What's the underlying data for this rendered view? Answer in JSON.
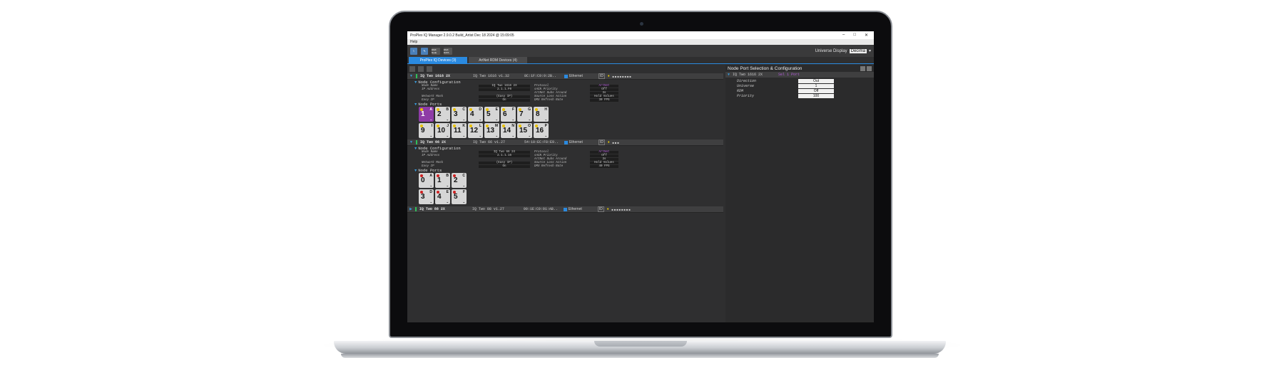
{
  "app": {
    "title": "ProPlex IQ Manager 2.9.0.2 Build_Artist Dec 18 2024 @ 15:09:05",
    "menu": "Help"
  },
  "toolbar": {
    "icon_a": "DMX Node",
    "icon_b": "DMX DATA",
    "universe_label": "Universe Display",
    "universe_value": "Decima"
  },
  "tabs": [
    "ProPlex IQ Devices (3)",
    "ArtNet RDM Devices (4)"
  ],
  "devices": [
    {
      "name": "IQ Two 1616 2X",
      "firmware": "IQ Two 1616 v1.32",
      "mac": "8C:1F:C9:9:2B..",
      "link": "Ethernet",
      "id": "ID",
      "config": {
        "node_name_label": "Node Name",
        "node_name": "IQ Two 1616 2X",
        "ip_label": "IP Address",
        "ip": "2.1.1.F0",
        "mask_label": "Network Mask",
        "mask": "(Easy IP)",
        "easy_ip_label": "Easy IP",
        "easy_ip": "On",
        "protocol_label": "Protocol",
        "protocol": "ArtNet",
        "sacn_label": "sACN Priority",
        "sacn": "Off",
        "artnet_label": "ArtNet Subs Around",
        "artnet": "3s",
        "source_label": "Source Loss Action",
        "source": "Hold Values",
        "refresh_label": "DMX Refresh Rate",
        "refresh": "30 FPS"
      },
      "ports": [
        {
          "num": "1",
          "let": "A"
        },
        {
          "num": "2",
          "let": "B"
        },
        {
          "num": "3",
          "let": "C"
        },
        {
          "num": "4",
          "let": "D"
        },
        {
          "num": "5",
          "let": "E"
        },
        {
          "num": "6",
          "let": "F"
        },
        {
          "num": "7",
          "let": "G"
        },
        {
          "num": "8",
          "let": "H"
        },
        {
          "num": "9",
          "let": "I"
        },
        {
          "num": "10",
          "let": "J"
        },
        {
          "num": "11",
          "let": "K"
        },
        {
          "num": "12",
          "let": "L"
        },
        {
          "num": "13",
          "let": "M"
        },
        {
          "num": "14",
          "let": "N"
        },
        {
          "num": "15",
          "let": "O"
        },
        {
          "num": "16",
          "let": "P"
        }
      ]
    },
    {
      "name": "IQ Two 66 2X",
      "firmware": "IQ Two 66 v1.27",
      "mac": "54:10:EC:F8:E9..",
      "link": "Ethernet",
      "id": "ID",
      "config": {
        "node_name_label": "Node Name",
        "node_name": "IQ Two 66 2X",
        "ip_label": "IP Address",
        "ip": "2.1.1.16",
        "mask_label": "Network Mask",
        "mask": "(Easy IP)",
        "easy_ip_label": "Easy IP",
        "easy_ip": "On",
        "protocol_label": "Protocol",
        "protocol": "ArtNet",
        "sacn_label": "sACN Priority",
        "sacn": "Off",
        "artnet_label": "ArtNet Subs Around",
        "artnet": "3s",
        "source_label": "Source Loss Action",
        "source": "Hold Values",
        "refresh_label": "DMX Refresh Rate",
        "refresh": "40 FPS"
      },
      "ports": [
        {
          "num": "0",
          "let": "A"
        },
        {
          "num": "1",
          "let": "B"
        },
        {
          "num": "2",
          "let": "C"
        },
        {
          "num": "3",
          "let": "D"
        },
        {
          "num": "4",
          "let": "E"
        },
        {
          "num": "5",
          "let": "F"
        }
      ]
    },
    {
      "name": "IQ Two 88 2X",
      "firmware": "IQ Two 88 v1.27",
      "mac": "00:1E:C0:91:AB..",
      "link": "Ethernet",
      "id": "ID"
    }
  ],
  "section_titles": {
    "config": "Node Configuration",
    "ports": "Node Ports"
  },
  "right_panel": {
    "title": "Node Port Selection & Configuration",
    "device": "IQ Two 1616 2X",
    "port_label": "Sel 1 Port",
    "rows": [
      {
        "label": "Direction",
        "value": "Out"
      },
      {
        "label": "Universe",
        "value": "1"
      },
      {
        "label": "RDM",
        "value": "Off"
      },
      {
        "label": "Priority",
        "value": "100"
      }
    ]
  }
}
